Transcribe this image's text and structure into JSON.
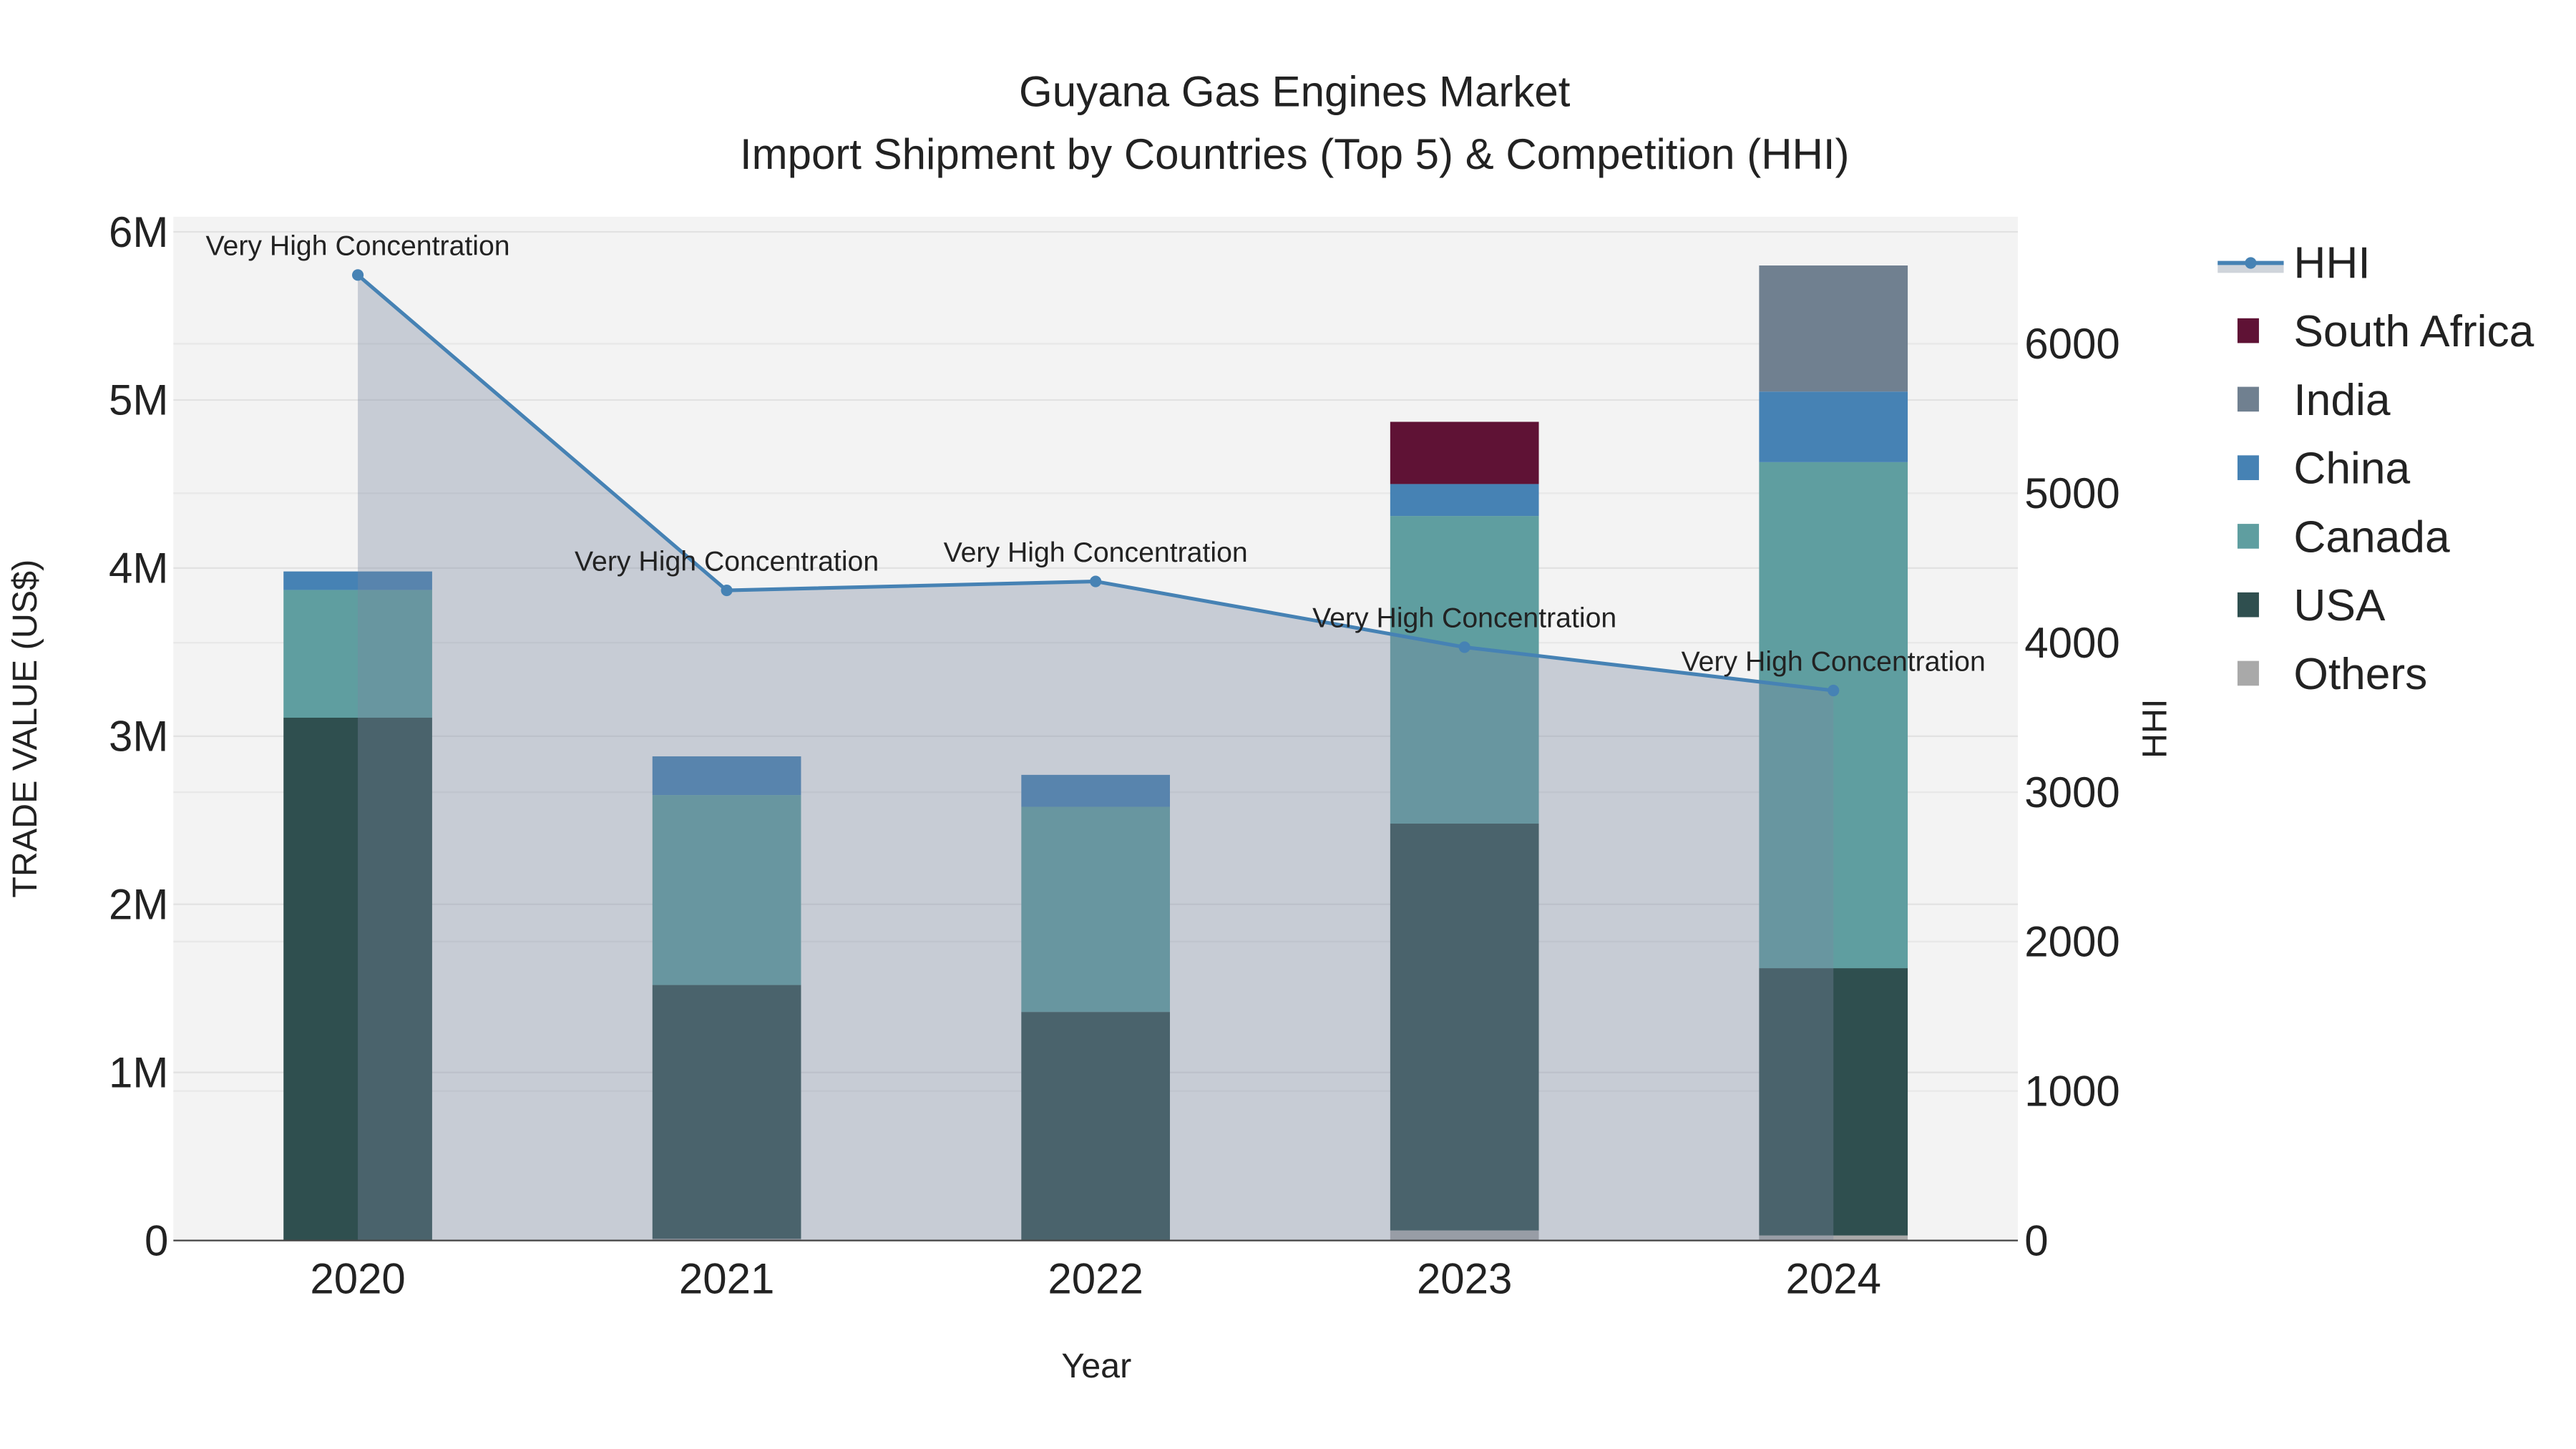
{
  "chart_data": {
    "type": "bar",
    "title": "Guyana Gas Engines Market",
    "subtitle": "Import Shipment by Countries (Top 5) & Competition (HHI)",
    "xlabel": "Year",
    "ylabel": "TRADE VALUE (US$)",
    "y2label": "HHI",
    "categories": [
      "2020",
      "2021",
      "2022",
      "2023",
      "2024"
    ],
    "ylim": [
      0,
      6090000
    ],
    "y2lim": [
      0,
      6850
    ],
    "yticks": [
      0,
      1000000,
      2000000,
      3000000,
      4000000,
      5000000,
      6000000
    ],
    "ytick_labels": [
      "0",
      "1M",
      "2M",
      "3M",
      "4M",
      "5M",
      "6M"
    ],
    "y2ticks": [
      0,
      1000,
      2000,
      3000,
      4000,
      5000,
      6000
    ],
    "y2tick_labels": [
      "0",
      "1000",
      "2000",
      "3000",
      "4000",
      "5000",
      "6000"
    ],
    "grid": true,
    "legend_position": "right",
    "series": [
      {
        "name": "Others",
        "color": "#a9a9a9",
        "values": [
          0,
          10000,
          0,
          60000,
          30000
        ]
      },
      {
        "name": "USA",
        "color": "#2f4f4f",
        "values": [
          3110000,
          1510000,
          1360000,
          2420000,
          1590000
        ]
      },
      {
        "name": "Canada",
        "color": "#5f9ea0",
        "values": [
          760000,
          1130000,
          1220000,
          1830000,
          3010000
        ]
      },
      {
        "name": "China",
        "color": "#4682b4",
        "values": [
          110000,
          230000,
          190000,
          190000,
          420000
        ]
      },
      {
        "name": "India",
        "color": "#708090",
        "values": [
          0,
          0,
          0,
          0,
          750000
        ]
      },
      {
        "name": "South Africa",
        "color": "#5f1235",
        "values": [
          0,
          0,
          0,
          370000,
          0
        ]
      }
    ],
    "hhi": {
      "name": "HHI",
      "color": "#4682b4",
      "values": [
        6460,
        4350,
        4410,
        3970,
        3680
      ],
      "annotations": [
        "Very High Concentration",
        "Very High Concentration",
        "Very High Concentration",
        "Very High Concentration",
        "Very High Concentration"
      ]
    },
    "legend_order": [
      "HHI",
      "South Africa",
      "India",
      "China",
      "Canada",
      "USA",
      "Others"
    ]
  }
}
